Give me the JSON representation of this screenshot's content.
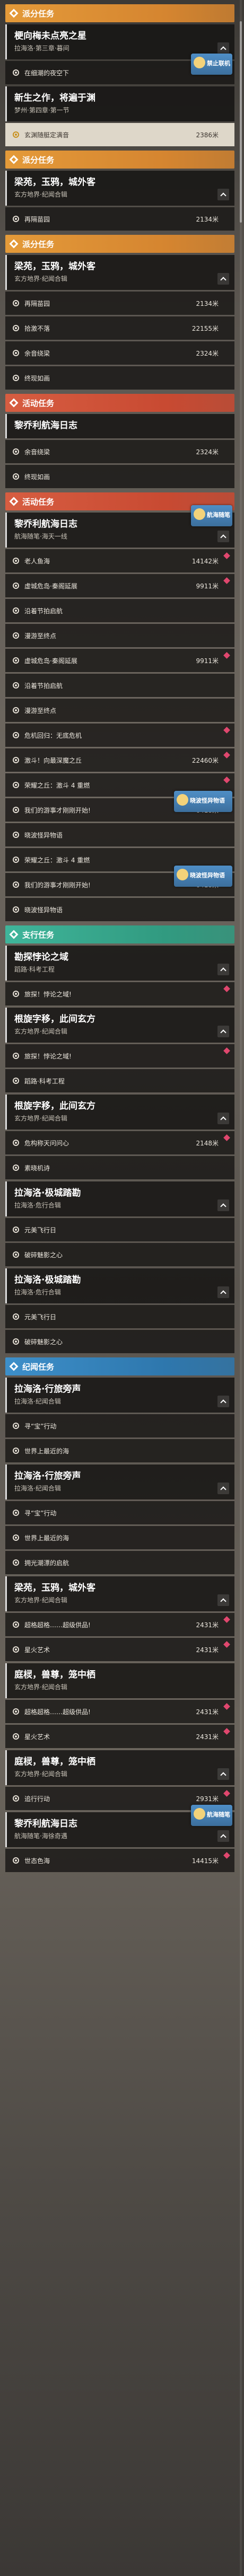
{
  "sections": [
    {
      "type": "sec",
      "color": "orange",
      "label": "派分任务"
    },
    {
      "type": "card",
      "title": "梗向梅未点亮之星",
      "sub": "拉海洛·第三章·暮间",
      "chev": true
    },
    {
      "type": "row",
      "text": "在细潮的夜空下",
      "dist": "",
      "marker": false
    },
    {
      "type": "tag",
      "text": "禁止联机",
      "wide": false
    },
    {
      "type": "card",
      "title": "新生之作，将遍于渊",
      "sub": "梦州·第四章·第一节",
      "chev": false
    },
    {
      "type": "row",
      "text": "玄渊随艇定满音",
      "dist": "2386米",
      "marker": false,
      "highlight": true
    },
    {
      "type": "sec",
      "color": "orange",
      "label": "派分任务"
    },
    {
      "type": "card",
      "title": "梁苑，玉鸦，城外客",
      "sub": "玄方地界·纪闻合辑",
      "chev": true
    },
    {
      "type": "row",
      "text": "再隔苗园",
      "dist": "2134米",
      "marker": false
    },
    {
      "type": "sec",
      "color": "orange",
      "label": "派分任务"
    },
    {
      "type": "card",
      "title": "梁苑，玉鸦，城外客",
      "sub": "玄方地界·纪闻合辑",
      "chev": true
    },
    {
      "type": "row",
      "text": "再隔苗园",
      "dist": "2134米",
      "marker": false
    },
    {
      "type": "row",
      "text": "拾激不落",
      "dist": "22155米",
      "marker": false
    },
    {
      "type": "row",
      "text": "余音绕梁",
      "dist": "2324米",
      "marker": false
    },
    {
      "type": "row",
      "text": "终现如画",
      "dist": "",
      "marker": false
    },
    {
      "type": "sec",
      "color": "red",
      "label": "活动任务"
    },
    {
      "type": "card",
      "title": "黎乔利航海日志",
      "sub": "",
      "chev": false
    },
    {
      "type": "row",
      "text": "余音绕梁",
      "dist": "2324米",
      "marker": false
    },
    {
      "type": "row",
      "text": "终现如画",
      "dist": "",
      "marker": false
    },
    {
      "type": "sec",
      "color": "red",
      "label": "活动任务"
    },
    {
      "type": "card",
      "title": "黎乔利航海日志",
      "sub": "航海随笔·海天一线",
      "chev": true
    },
    {
      "type": "tag",
      "text": "航海随笔",
      "wide": false
    },
    {
      "type": "row",
      "text": "老人鱼海",
      "dist": "14142米",
      "marker": true
    },
    {
      "type": "row",
      "text": "虚城危岛·秦阁延展",
      "dist": "9911米",
      "marker": true
    },
    {
      "type": "row",
      "text": "沿着节拍启航",
      "dist": "",
      "marker": false
    },
    {
      "type": "row",
      "text": "漫游至终点",
      "dist": "",
      "marker": false
    },
    {
      "type": "row",
      "text": "虚城危岛·秦阁延展",
      "dist": "9911米",
      "marker": true
    },
    {
      "type": "row",
      "text": "沿着节拍启航",
      "dist": "",
      "marker": false
    },
    {
      "type": "row",
      "text": "漫游至终点",
      "dist": "",
      "marker": false
    },
    {
      "type": "row",
      "text": "危机回归：无底危机",
      "dist": "",
      "marker": true
    },
    {
      "type": "row",
      "text": "激斗！向最深魔之丘",
      "dist": "22460米",
      "marker": true
    },
    {
      "type": "row",
      "text": "荣耀之丘：激斗 4 重燃",
      "dist": "",
      "marker": true
    },
    {
      "type": "row",
      "text": "我们的游事才刚刚开始!",
      "dist": "6418米",
      "marker": true
    },
    {
      "type": "tag",
      "text": "晓波怪异物语",
      "wide": true
    },
    {
      "type": "row",
      "text": "晓波怪异物语",
      "dist": "",
      "marker": false
    },
    {
      "type": "row",
      "text": "荣耀之丘：激斗 4 重燃",
      "dist": "",
      "marker": false
    },
    {
      "type": "row",
      "text": "我们的游事才刚刚开始!",
      "dist": "6418米",
      "marker": true
    },
    {
      "type": "tag",
      "text": "晓波怪异物语",
      "wide": true
    },
    {
      "type": "row",
      "text": "晓波怪异物语",
      "dist": "",
      "marker": false
    },
    {
      "type": "sec",
      "color": "teal",
      "label": "支行任务"
    },
    {
      "type": "card",
      "title": "勘探悖论之域",
      "sub": "蹈路·科考工程",
      "chev": true
    },
    {
      "type": "row",
      "text": "旅探！悖论之域!",
      "dist": "",
      "marker": true
    },
    {
      "type": "card",
      "title": "根旋字移，此间玄方",
      "sub": "玄方地界·纪闻合辑",
      "chev": true
    },
    {
      "type": "row",
      "text": "旅探！悖论之域!",
      "dist": "",
      "marker": true
    },
    {
      "type": "row",
      "text": "蹈路·科考工程",
      "dist": "",
      "marker": false
    },
    {
      "type": "card",
      "title": "根旋字移，此间玄方",
      "sub": "玄方地界·纪闻合辑",
      "chev": true
    },
    {
      "type": "row",
      "text": "危构称天问问心",
      "dist": "2148米",
      "marker": true
    },
    {
      "type": "row",
      "text": "素晓机诗",
      "dist": "",
      "marker": false
    },
    {
      "type": "card",
      "title": "拉海洛·极城踏勘",
      "sub": "拉海洛·危行合辑",
      "chev": true
    },
    {
      "type": "row",
      "text": "元美飞行日",
      "dist": "",
      "marker": false
    },
    {
      "type": "row",
      "text": "破碎魅影之心",
      "dist": "",
      "marker": false
    },
    {
      "type": "card",
      "title": "拉海洛·极城踏勘",
      "sub": "拉海洛·危行合辑",
      "chev": true
    },
    {
      "type": "row",
      "text": "元美飞行日",
      "dist": "",
      "marker": false
    },
    {
      "type": "row",
      "text": "破碎魅影之心",
      "dist": "",
      "marker": false
    },
    {
      "type": "sec",
      "color": "blue",
      "label": "纪闻任务"
    },
    {
      "type": "card",
      "title": "拉海洛·行旅旁声",
      "sub": "拉海洛·纪闻合辑",
      "chev": true
    },
    {
      "type": "row",
      "text": "寻“宝”行动",
      "dist": "",
      "marker": false
    },
    {
      "type": "row",
      "text": "世界上最近的海",
      "dist": "",
      "marker": false
    },
    {
      "type": "card",
      "title": "拉海洛·行旅旁声",
      "sub": "拉海洛·纪闻合辑",
      "chev": true
    },
    {
      "type": "row",
      "text": "寻“宝”行动",
      "dist": "",
      "marker": false
    },
    {
      "type": "row",
      "text": "世界上最近的海",
      "dist": "",
      "marker": false
    },
    {
      "type": "row",
      "text": "拥光潮漂的启航",
      "dist": "",
      "marker": false
    },
    {
      "type": "card",
      "title": "梁苑，玉鸦，城外客",
      "sub": "玄方地界·纪闻合辑",
      "chev": true
    },
    {
      "type": "row",
      "text": "超格超格……超级供品!",
      "dist": "2431米",
      "marker": true
    },
    {
      "type": "row",
      "text": "星火艺术",
      "dist": "2431米",
      "marker": true
    },
    {
      "type": "card",
      "title": "庭棂，兽尊，笼中栖",
      "sub": "玄方地界·纪闻合辑",
      "chev": false
    },
    {
      "type": "row",
      "text": "超格超格……超级供品!",
      "dist": "2431米",
      "marker": true
    },
    {
      "type": "row",
      "text": "星火艺术",
      "dist": "2431米",
      "marker": true
    },
    {
      "type": "card",
      "title": "庭棂，兽尊，笼中栖",
      "sub": "玄方地界·纪闻合辑",
      "chev": true
    },
    {
      "type": "row",
      "text": "追行行动",
      "dist": "2931米",
      "marker": true
    },
    {
      "type": "card",
      "title": "黎乔利航海日志",
      "sub": "航海随笔·海徐奇遇",
      "chev": true
    },
    {
      "type": "tag",
      "text": "航海随笔",
      "wide": false
    },
    {
      "type": "row",
      "text": "世态色海",
      "dist": "14415米",
      "marker": true
    }
  ],
  "colors": {
    "orange": "#e49a39",
    "red": "#d75d41",
    "teal": "#3fb59a",
    "blue": "#3d8fc9",
    "marker": "#e0476e"
  }
}
